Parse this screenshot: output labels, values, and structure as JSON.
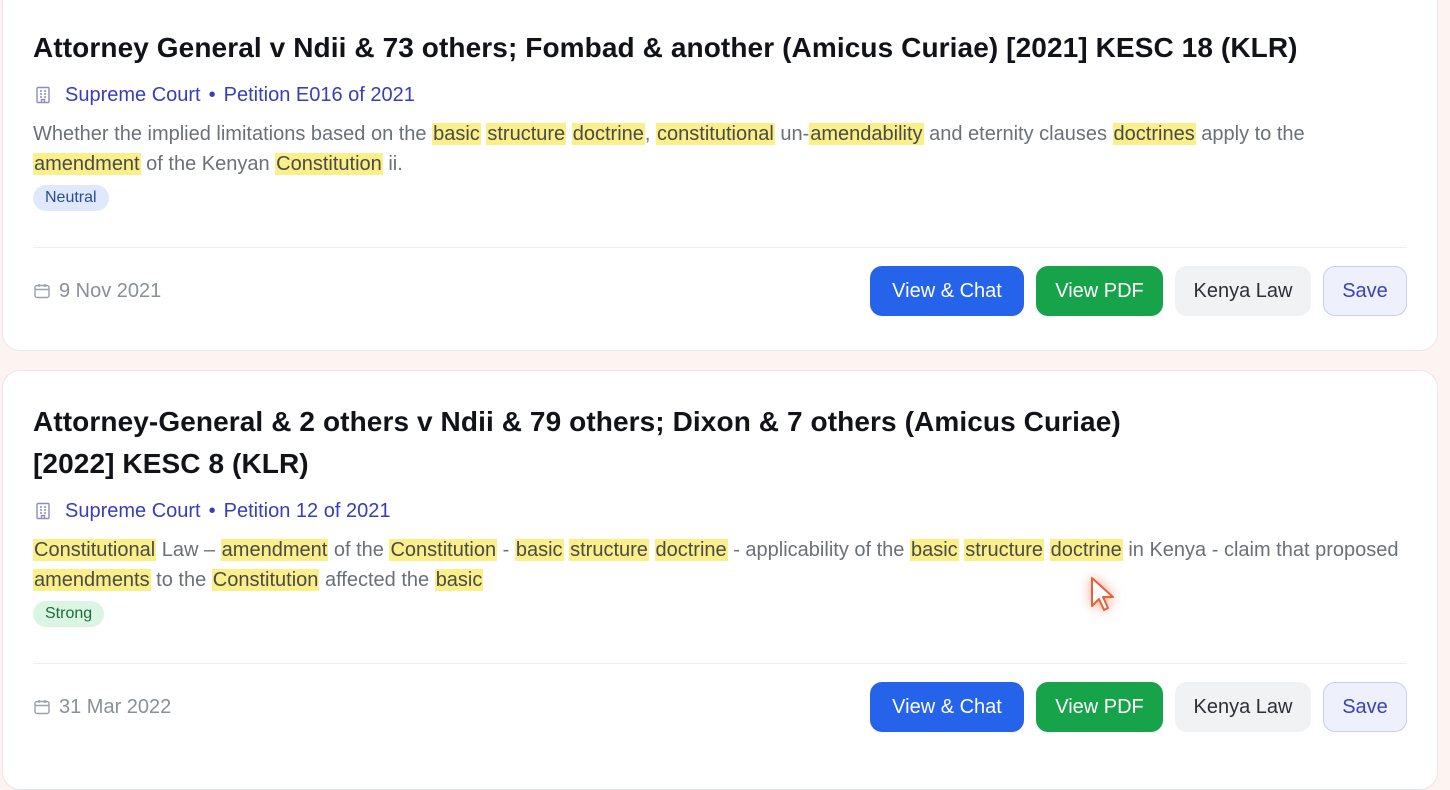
{
  "results": [
    {
      "title": "Attorney General v Ndii & 73 others; Fombad & another (Amicus Curiae) [2021] KESC 18 (KLR)",
      "court": "Supreme Court",
      "separator": "•",
      "case_number": "Petition E016 of 2021",
      "snippet": [
        {
          "t": "Whether the implied limitations based on the ",
          "h": false
        },
        {
          "t": "basic",
          "h": true
        },
        {
          "t": " ",
          "h": false
        },
        {
          "t": "structure",
          "h": true
        },
        {
          "t": " ",
          "h": false
        },
        {
          "t": "doctrine",
          "h": true
        },
        {
          "t": ", ",
          "h": false
        },
        {
          "t": "constitutional",
          "h": true
        },
        {
          "t": " un-",
          "h": false
        },
        {
          "t": "amendability",
          "h": true
        },
        {
          "t": " and eternity clauses ",
          "h": false
        },
        {
          "t": "doctrines",
          "h": true
        },
        {
          "t": " apply to the ",
          "h": false
        },
        {
          "t": "amendment",
          "h": true
        },
        {
          "t": " of the Kenyan ",
          "h": false
        },
        {
          "t": "Constitution",
          "h": true
        },
        {
          "t": " ii.",
          "h": false
        }
      ],
      "badge": "Neutral",
      "badge_type": "neutral",
      "date": "9 Nov 2021",
      "buttons": {
        "view_chat": "View & Chat",
        "view_pdf": "View PDF",
        "source": "Kenya Law",
        "save": "Save"
      }
    },
    {
      "title": "Attorney-General & 2 others v Ndii & 79 others; Dixon & 7 others (Amicus Curiae) [2022] KESC 8 (KLR)",
      "court": "Supreme Court",
      "separator": "•",
      "case_number": "Petition 12 of 2021",
      "snippet": [
        {
          "t": "Constitutional",
          "h": true
        },
        {
          "t": " Law – ",
          "h": false
        },
        {
          "t": "amendment",
          "h": true
        },
        {
          "t": " of the ",
          "h": false
        },
        {
          "t": "Constitution",
          "h": true
        },
        {
          "t": " - ",
          "h": false
        },
        {
          "t": "basic",
          "h": true
        },
        {
          "t": " ",
          "h": false
        },
        {
          "t": "structure",
          "h": true
        },
        {
          "t": " ",
          "h": false
        },
        {
          "t": "doctrine",
          "h": true
        },
        {
          "t": " - applicability of the ",
          "h": false
        },
        {
          "t": "basic",
          "h": true
        },
        {
          "t": " ",
          "h": false
        },
        {
          "t": "structure",
          "h": true
        },
        {
          "t": " ",
          "h": false
        },
        {
          "t": "doctrine",
          "h": true
        },
        {
          "t": " in Kenya - claim that proposed ",
          "h": false
        },
        {
          "t": "amendments",
          "h": true
        },
        {
          "t": " to the ",
          "h": false
        },
        {
          "t": "Constitution",
          "h": true
        },
        {
          "t": " affected the ",
          "h": false
        },
        {
          "t": "basic",
          "h": true
        }
      ],
      "badge": "Strong",
      "badge_type": "strong",
      "date": "31 Mar 2022",
      "buttons": {
        "view_chat": "View & Chat",
        "view_pdf": "View PDF",
        "source": "Kenya Law",
        "save": "Save"
      }
    }
  ],
  "icons": {
    "court": "building-icon",
    "date": "calendar-icon",
    "pointer": "cursor-pointer-icon"
  },
  "colors": {
    "highlight": "#fbef8a",
    "primary": "#2563eb",
    "success": "#16a34a",
    "link": "#3a3dbb"
  }
}
